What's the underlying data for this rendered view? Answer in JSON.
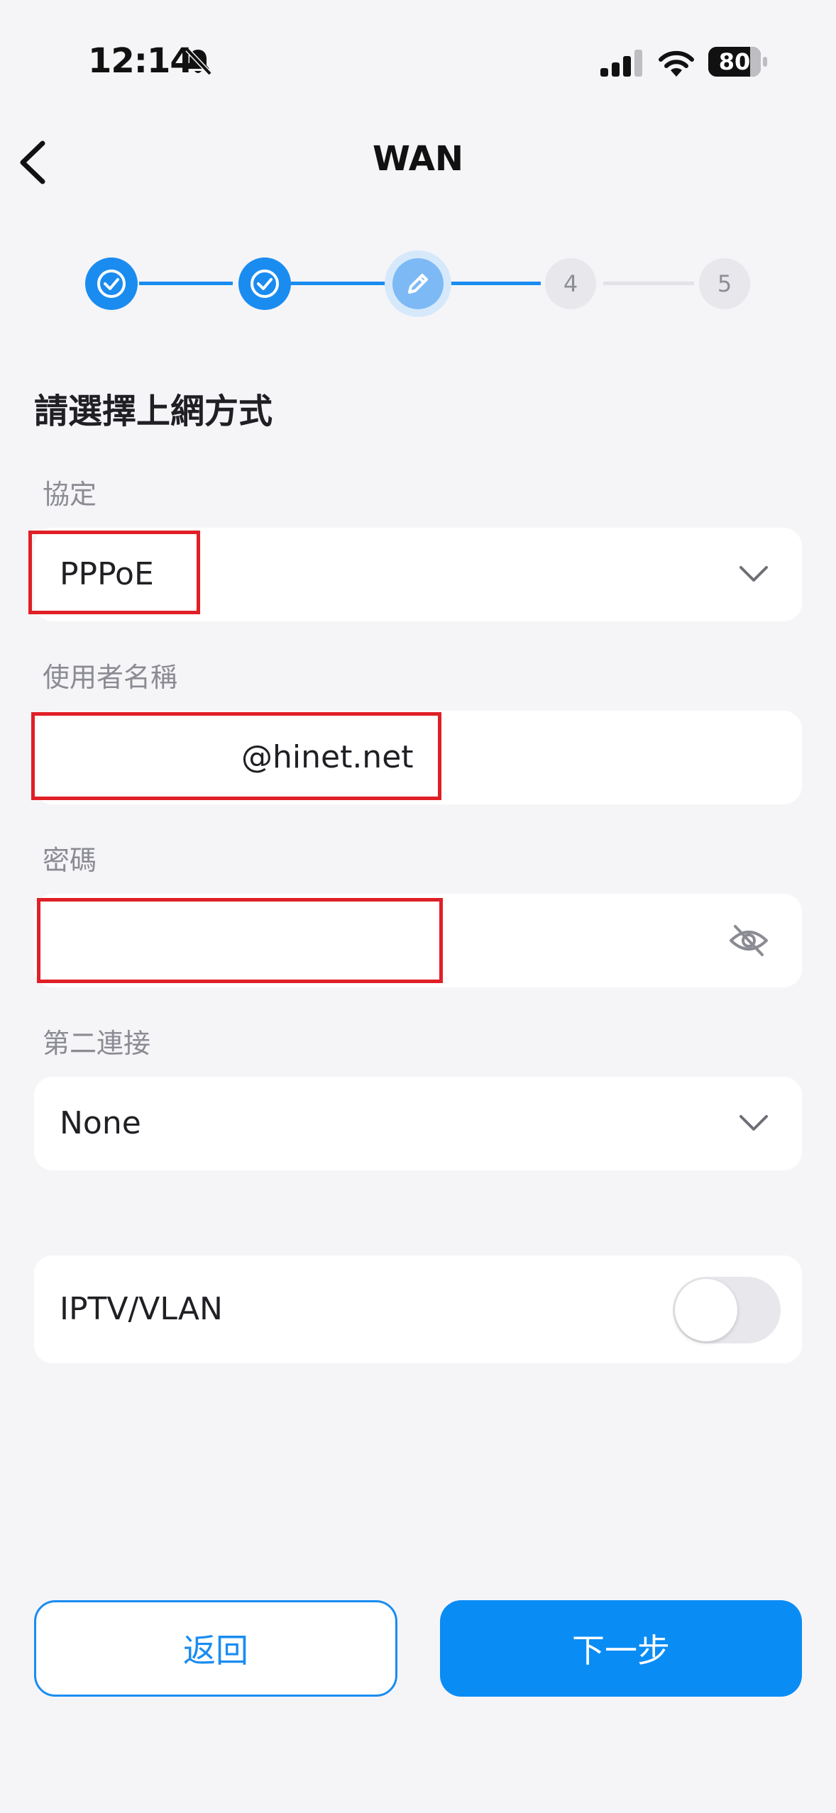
{
  "status_bar": {
    "time": "12:14",
    "battery": "80",
    "battery_level": 0.8
  },
  "nav": {
    "title": "WAN"
  },
  "stepper": {
    "steps": [
      {
        "state": "done"
      },
      {
        "state": "done"
      },
      {
        "state": "active"
      },
      {
        "state": "todo",
        "label": "4"
      },
      {
        "state": "todo",
        "label": "5"
      }
    ]
  },
  "form": {
    "section_title": "請選擇上網方式",
    "protocol": {
      "label": "協定",
      "value": "PPPoE"
    },
    "username": {
      "label": "使用者名稱",
      "value": "@hinet.net"
    },
    "password": {
      "label": "密碼",
      "value": ""
    },
    "second_connection": {
      "label": "第二連接",
      "value": "None"
    },
    "iptv": {
      "label": "IPTV/VLAN",
      "enabled": false
    }
  },
  "buttons": {
    "back": "返回",
    "next": "下一步"
  },
  "colors": {
    "accent": "#1a8cf0",
    "highlight": "#e01f26"
  }
}
